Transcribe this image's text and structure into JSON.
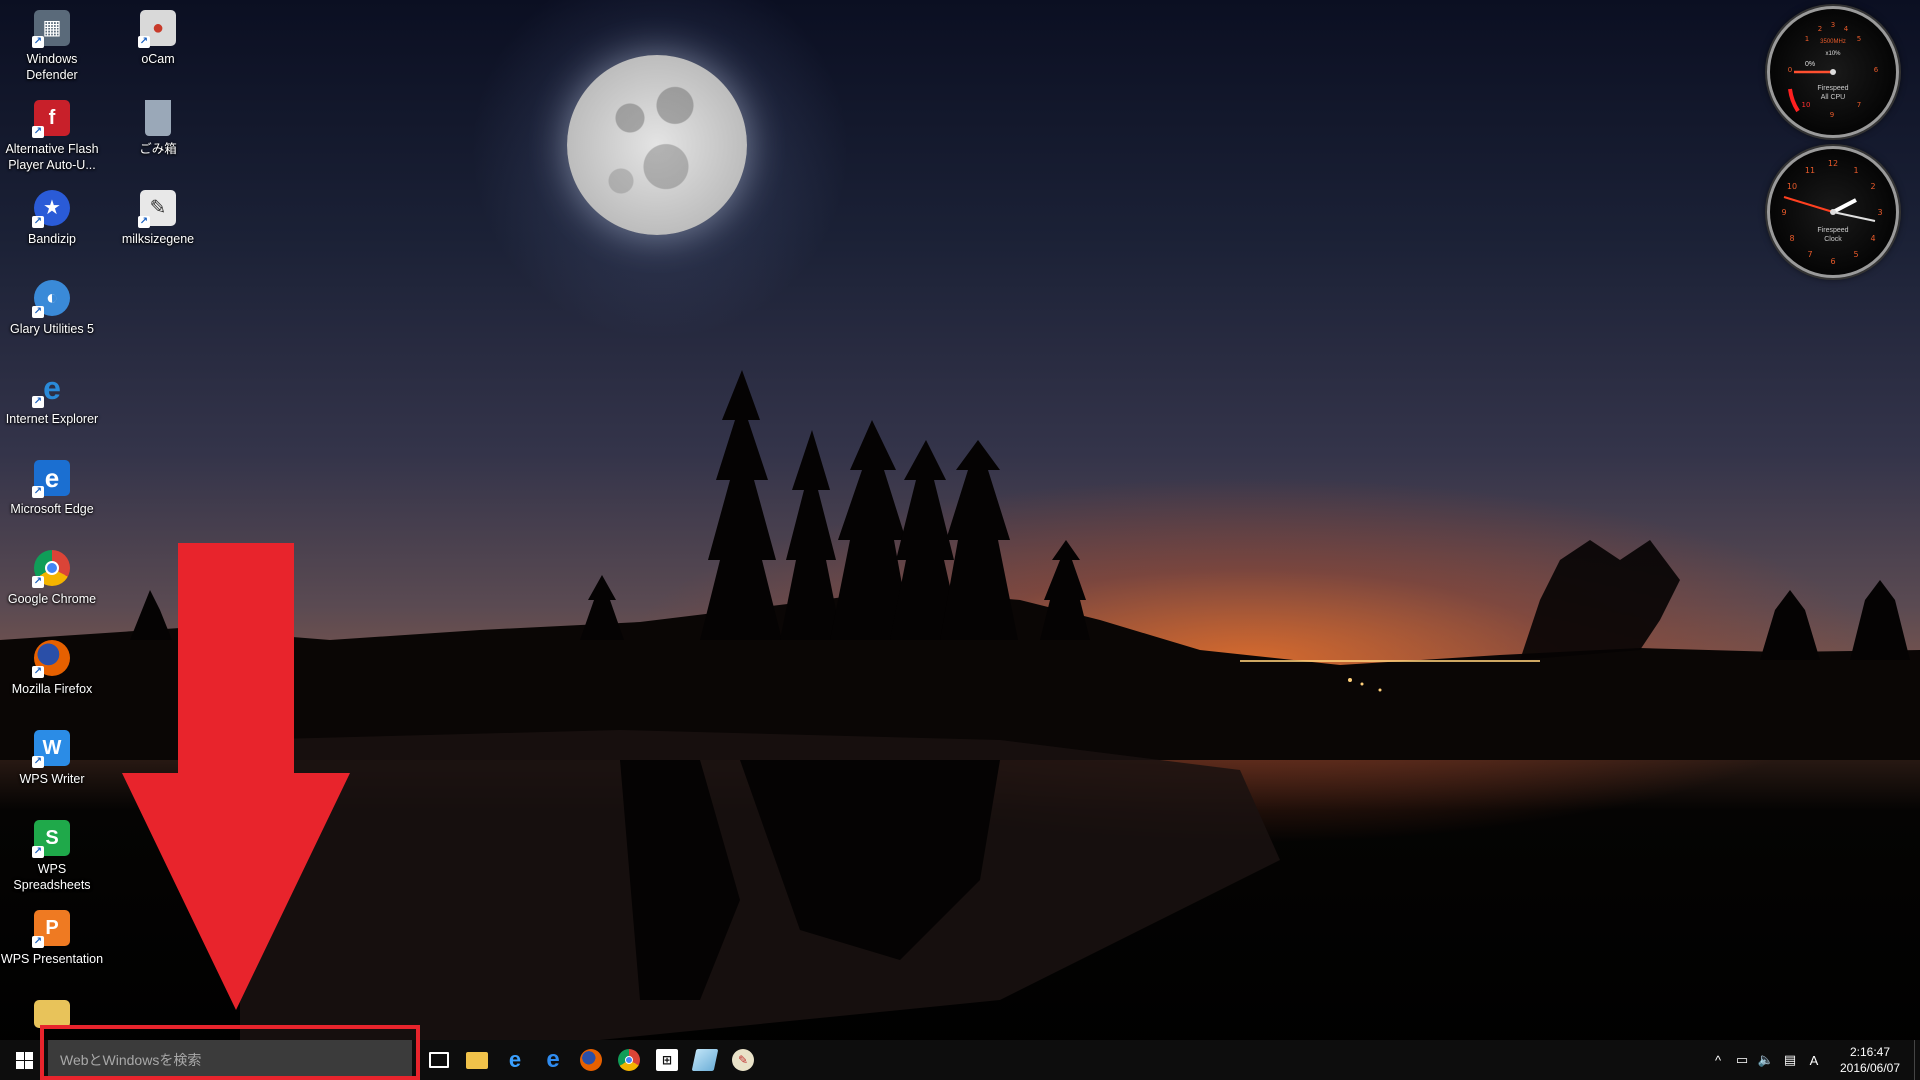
{
  "desktop": {
    "icons": [
      {
        "label": "Windows Defender",
        "icon": "castle-wall-icon",
        "color": "#5a6a7a"
      },
      {
        "label": "oCam",
        "icon": "ocam-icon",
        "color": "#d9d9d9"
      },
      {
        "label": "Alternative Flash Player Auto-U...",
        "icon": "flash-player-icon",
        "color": "#c8202a"
      },
      {
        "label": "ごみ箱",
        "icon": "recycle-bin-icon",
        "color": "#9aa8b8"
      },
      {
        "label": "Bandizip",
        "icon": "bandizip-icon",
        "color": "#2a5bd7"
      },
      {
        "label": "milksizegene",
        "icon": "milksizegene-icon",
        "color": "#e8e8e8"
      },
      {
        "label": "Glary Utilities 5",
        "icon": "glary-utilities-icon",
        "color": "#3a8ad8"
      },
      {
        "label": "Internet Explorer",
        "icon": "internet-explorer-icon",
        "color": "#2a8ad8"
      },
      {
        "label": "Microsoft Edge",
        "icon": "microsoft-edge-icon",
        "color": "#1b6fd1"
      },
      {
        "label": "Google Chrome",
        "icon": "google-chrome-icon",
        "color": "#db4437"
      },
      {
        "label": "Mozilla Firefox",
        "icon": "firefox-icon",
        "color": "#e66000"
      },
      {
        "label": "WPS Writer",
        "icon": "wps-writer-icon",
        "color": "#2b8ce6"
      },
      {
        "label": "WPS Spreadsheets",
        "icon": "wps-spreadsheets-icon",
        "color": "#1fa94a"
      },
      {
        "label": "WPS Presentation",
        "icon": "wps-presentation-icon",
        "color": "#ef7a22"
      },
      {
        "label": "",
        "icon": "folder-shortcut-icon",
        "color": "#e8c35a"
      }
    ]
  },
  "gadgets": {
    "cpu": {
      "name": "Firespeed",
      "sub": "All CPU",
      "freq": "3500MHz",
      "mult": "x10%",
      "usage": "0%"
    },
    "clock": {
      "name": "Firespeed",
      "sub": "Clock"
    }
  },
  "taskbar": {
    "search_placeholder": "WebとWindowsを検索",
    "pinned": [
      {
        "name": "task-view-icon"
      },
      {
        "name": "file-explorer-icon"
      },
      {
        "name": "internet-explorer-icon"
      },
      {
        "name": "microsoft-edge-icon"
      },
      {
        "name": "firefox-icon"
      },
      {
        "name": "chrome-icon"
      },
      {
        "name": "store-icon"
      },
      {
        "name": "notepad-icon"
      },
      {
        "name": "paint-icon"
      }
    ],
    "tray": {
      "ime": "A",
      "time": "2:16:47",
      "date": "2016/06/07"
    }
  },
  "colors": {
    "annotation_red": "#e8242c",
    "taskbar_bg": "#0d0d0d",
    "search_bg": "#3b3b3b"
  }
}
